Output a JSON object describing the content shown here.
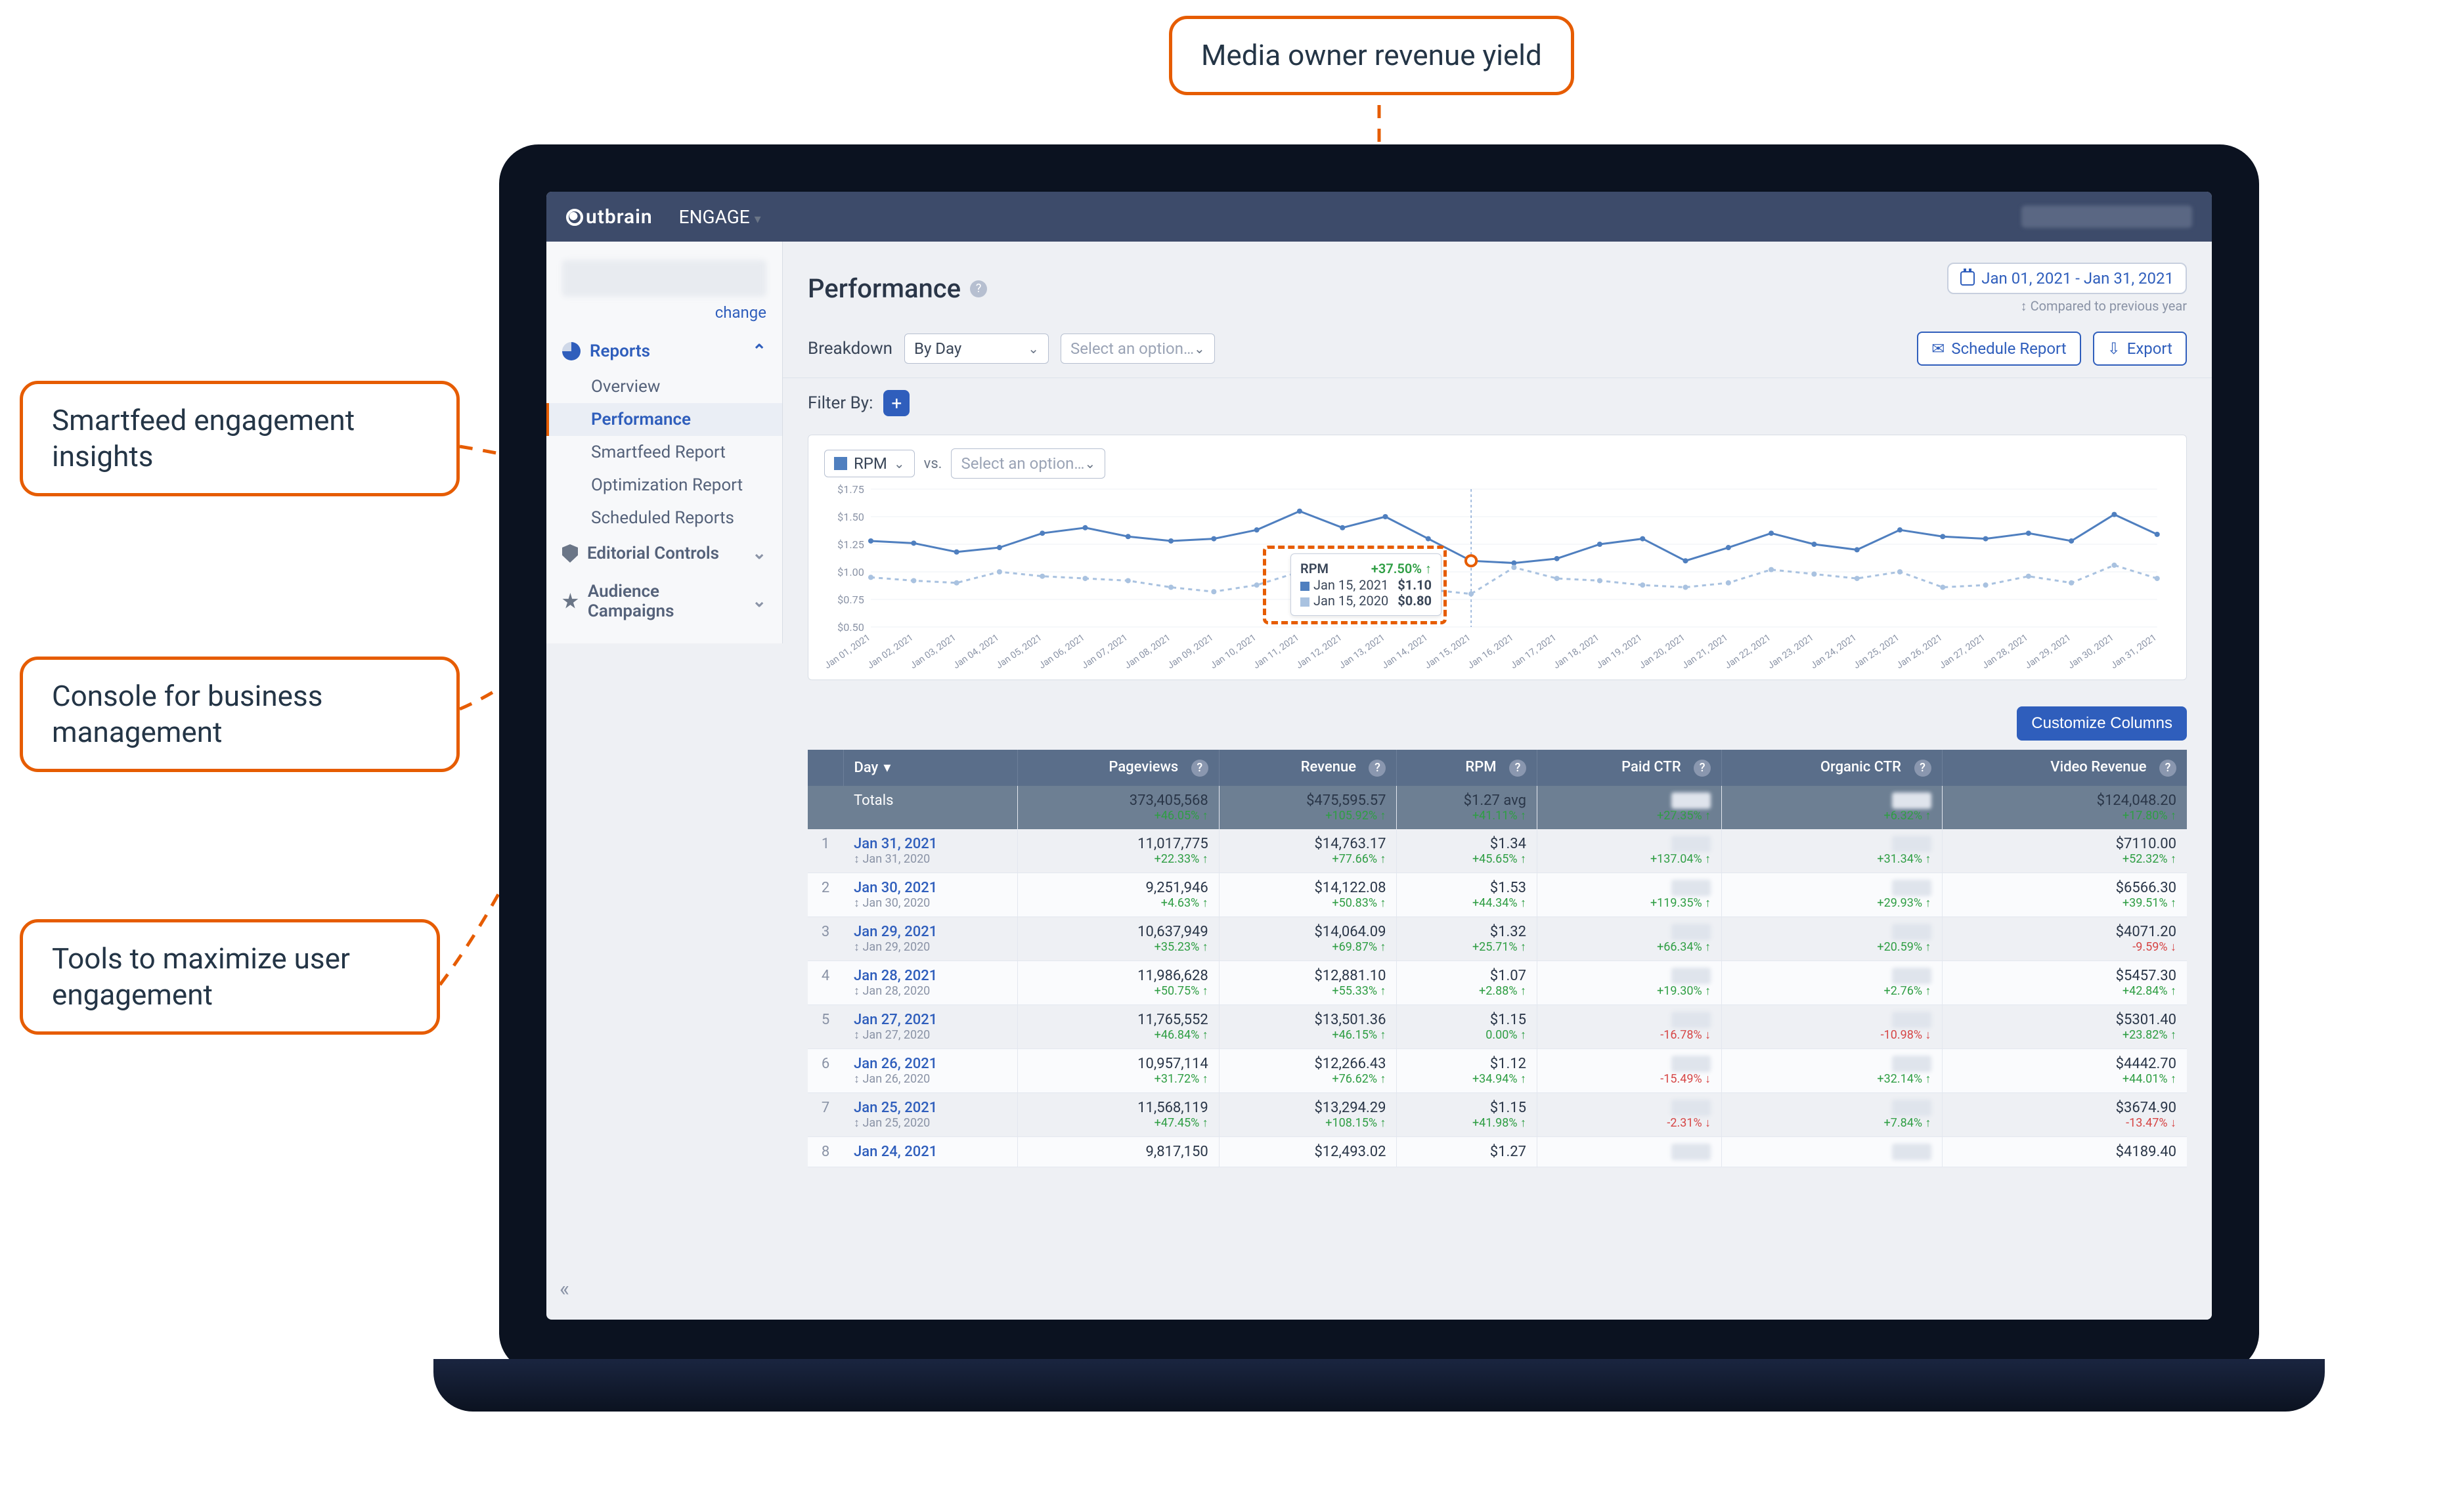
{
  "annotations": {
    "top": "Media owner revenue yield",
    "left1": "Smartfeed engagement insights",
    "left2": "Console for business management",
    "left3": "Tools to maximize user engagement"
  },
  "topbar": {
    "brand": "utbrain",
    "menu": "ENGAGE"
  },
  "sidebar": {
    "change": "change",
    "reports_label": "Reports",
    "items": [
      "Overview",
      "Performance",
      "Smartfeed Report",
      "Optimization Report",
      "Scheduled Reports"
    ],
    "editorial": "Editorial Controls",
    "audience": "Audience Campaigns"
  },
  "header": {
    "title": "Performance",
    "date_range": "Jan 01, 2021 - Jan 31, 2021",
    "compare_note": "↕ Compared to previous year"
  },
  "controls": {
    "breakdown_label": "Breakdown",
    "breakdown_value": "By Day",
    "breakdown2_placeholder": "Select an option…",
    "schedule": "Schedule Report",
    "export": "Export",
    "filter_label": "Filter By:"
  },
  "chart": {
    "metric": "RPM",
    "vs": "vs.",
    "compare_placeholder": "Select an option…",
    "y_ticks": [
      "$1.75",
      "$1.50",
      "$1.25",
      "$1.00",
      "$0.75",
      "$0.50"
    ],
    "tooltip": {
      "metric": "RPM",
      "pct": "+37.50% ↑",
      "d1_label": "Jan 15, 2021",
      "d1_val": "$1.10",
      "d2_label": "Jan 15, 2020",
      "d2_val": "$0.80"
    }
  },
  "chart_data": {
    "type": "line",
    "ylabel": "RPM ($)",
    "ylim": [
      0.5,
      1.75
    ],
    "categories": [
      "Jan 01, 2021",
      "Jan 02, 2021",
      "Jan 03, 2021",
      "Jan 04, 2021",
      "Jan 05, 2021",
      "Jan 06, 2021",
      "Jan 07, 2021",
      "Jan 08, 2021",
      "Jan 09, 2021",
      "Jan 10, 2021",
      "Jan 11, 2021",
      "Jan 12, 2021",
      "Jan 13, 2021",
      "Jan 14, 2021",
      "Jan 15, 2021",
      "Jan 16, 2021",
      "Jan 17, 2021",
      "Jan 18, 2021",
      "Jan 19, 2021",
      "Jan 20, 2021",
      "Jan 21, 2021",
      "Jan 22, 2021",
      "Jan 23, 2021",
      "Jan 24, 2021",
      "Jan 25, 2021",
      "Jan 26, 2021",
      "Jan 27, 2021",
      "Jan 28, 2021",
      "Jan 29, 2021",
      "Jan 30, 2021",
      "Jan 31, 2021"
    ],
    "series": [
      {
        "name": "RPM (2021)",
        "color": "#4f7fbf",
        "values": [
          1.28,
          1.26,
          1.18,
          1.22,
          1.35,
          1.4,
          1.32,
          1.28,
          1.3,
          1.38,
          1.55,
          1.4,
          1.5,
          1.3,
          1.1,
          1.08,
          1.12,
          1.25,
          1.3,
          1.1,
          1.22,
          1.35,
          1.25,
          1.2,
          1.38,
          1.32,
          1.3,
          1.35,
          1.28,
          1.52,
          1.34
        ]
      },
      {
        "name": "RPM (2020)",
        "color": "#a9c2e0",
        "values": [
          0.95,
          0.92,
          0.9,
          1.0,
          0.96,
          0.94,
          0.92,
          0.86,
          0.82,
          0.88,
          1.0,
          0.96,
          0.88,
          0.84,
          0.8,
          1.04,
          0.94,
          0.92,
          0.88,
          0.86,
          0.9,
          1.02,
          0.98,
          0.94,
          1.0,
          0.86,
          0.88,
          0.96,
          0.9,
          1.06,
          0.94
        ]
      }
    ]
  },
  "table": {
    "customize": "Customize Columns",
    "columns": [
      "Day",
      "Pageviews",
      "Revenue",
      "RPM",
      "Paid CTR",
      "Organic CTR",
      "Video Revenue"
    ],
    "totals": {
      "label": "Totals",
      "pageviews": {
        "v": "373,405,568",
        "pct": "+46.05% ↑"
      },
      "revenue": {
        "v": "$475,595.57",
        "pct": "+105.92% ↑"
      },
      "rpm": {
        "v": "$1.27 avg",
        "pct": "+41.11% ↑"
      },
      "paid": {
        "v": "avg",
        "pct": "+27.35% ↑",
        "blur": true
      },
      "organic": {
        "v": "",
        "pct": "+6.32% ↑",
        "blur": true
      },
      "video": {
        "v": "$124,048.20",
        "pct": "+17.80% ↑"
      }
    },
    "rows": [
      {
        "i": 1,
        "day": "Jan 31, 2021",
        "prev": "↕ Jan 31, 2020",
        "pv": {
          "v": "11,017,775",
          "pct": "+22.33% ↑"
        },
        "rev": {
          "v": "$14,763.17",
          "pct": "+77.66% ↑"
        },
        "rpm": {
          "v": "$1.34",
          "pct": "+45.65% ↑"
        },
        "paid": {
          "pct": "+137.04% ↑"
        },
        "org": {
          "pct": "+31.34% ↑"
        },
        "vid": {
          "v": "$7110.00",
          "pct": "+52.32% ↑"
        }
      },
      {
        "i": 2,
        "day": "Jan 30, 2021",
        "prev": "↕ Jan 30, 2020",
        "pv": {
          "v": "9,251,946",
          "pct": "+4.63% ↑"
        },
        "rev": {
          "v": "$14,122.08",
          "pct": "+50.83% ↑"
        },
        "rpm": {
          "v": "$1.53",
          "pct": "+44.34% ↑"
        },
        "paid": {
          "pct": "+119.35% ↑"
        },
        "org": {
          "pct": "+29.93% ↑"
        },
        "vid": {
          "v": "$6566.30",
          "pct": "+39.51% ↑"
        }
      },
      {
        "i": 3,
        "day": "Jan 29, 2021",
        "prev": "↕ Jan 29, 2020",
        "pv": {
          "v": "10,637,949",
          "pct": "+35.23% ↑"
        },
        "rev": {
          "v": "$14,064.09",
          "pct": "+69.87% ↑"
        },
        "rpm": {
          "v": "$1.32",
          "pct": "+25.71% ↑"
        },
        "paid": {
          "pct": "+66.34% ↑"
        },
        "org": {
          "pct": "+20.59% ↑"
        },
        "vid": {
          "v": "$4071.20",
          "pct": "-9.59% ↓",
          "down": true
        }
      },
      {
        "i": 4,
        "day": "Jan 28, 2021",
        "prev": "↕ Jan 28, 2020",
        "pv": {
          "v": "11,986,628",
          "pct": "+50.75% ↑"
        },
        "rev": {
          "v": "$12,881.10",
          "pct": "+55.33% ↑"
        },
        "rpm": {
          "v": "$1.07",
          "pct": "+2.88% ↑"
        },
        "paid": {
          "pct": "+19.30% ↑"
        },
        "org": {
          "pct": "+2.76% ↑"
        },
        "vid": {
          "v": "$5457.30",
          "pct": "+42.84% ↑"
        }
      },
      {
        "i": 5,
        "day": "Jan 27, 2021",
        "prev": "↕ Jan 27, 2020",
        "pv": {
          "v": "11,765,552",
          "pct": "+46.84% ↑"
        },
        "rev": {
          "v": "$13,501.36",
          "pct": "+46.15% ↑"
        },
        "rpm": {
          "v": "$1.15",
          "pct": "0.00% ↑"
        },
        "paid": {
          "pct": "-16.78% ↓",
          "down": true
        },
        "org": {
          "pct": "-10.98% ↓",
          "down": true
        },
        "vid": {
          "v": "$5301.40",
          "pct": "+23.82% ↑"
        }
      },
      {
        "i": 6,
        "day": "Jan 26, 2021",
        "prev": "↕ Jan 26, 2020",
        "pv": {
          "v": "10,957,114",
          "pct": "+31.72% ↑"
        },
        "rev": {
          "v": "$12,266.43",
          "pct": "+76.62% ↑"
        },
        "rpm": {
          "v": "$1.12",
          "pct": "+34.94% ↑"
        },
        "paid": {
          "pct": "-15.49% ↓",
          "down": true
        },
        "org": {
          "pct": "+32.14% ↑"
        },
        "vid": {
          "v": "$4442.70",
          "pct": "+44.01% ↑"
        }
      },
      {
        "i": 7,
        "day": "Jan 25, 2021",
        "prev": "↕ Jan 25, 2020",
        "pv": {
          "v": "11,568,119",
          "pct": "+47.45% ↑"
        },
        "rev": {
          "v": "$13,294.29",
          "pct": "+108.15% ↑"
        },
        "rpm": {
          "v": "$1.15",
          "pct": "+41.98% ↑"
        },
        "paid": {
          "pct": "-2.31% ↓",
          "down": true
        },
        "org": {
          "pct": "+7.84% ↑"
        },
        "vid": {
          "v": "$3674.90",
          "pct": "-13.47% ↓",
          "down": true
        }
      },
      {
        "i": 8,
        "day": "Jan 24, 2021",
        "prev": "",
        "pv": {
          "v": "9,817,150",
          "pct": ""
        },
        "rev": {
          "v": "$12,493.02",
          "pct": ""
        },
        "rpm": {
          "v": "$1.27",
          "pct": ""
        },
        "paid": {
          "pct": ""
        },
        "org": {
          "pct": ""
        },
        "vid": {
          "v": "$4189.40",
          "pct": ""
        }
      }
    ]
  }
}
